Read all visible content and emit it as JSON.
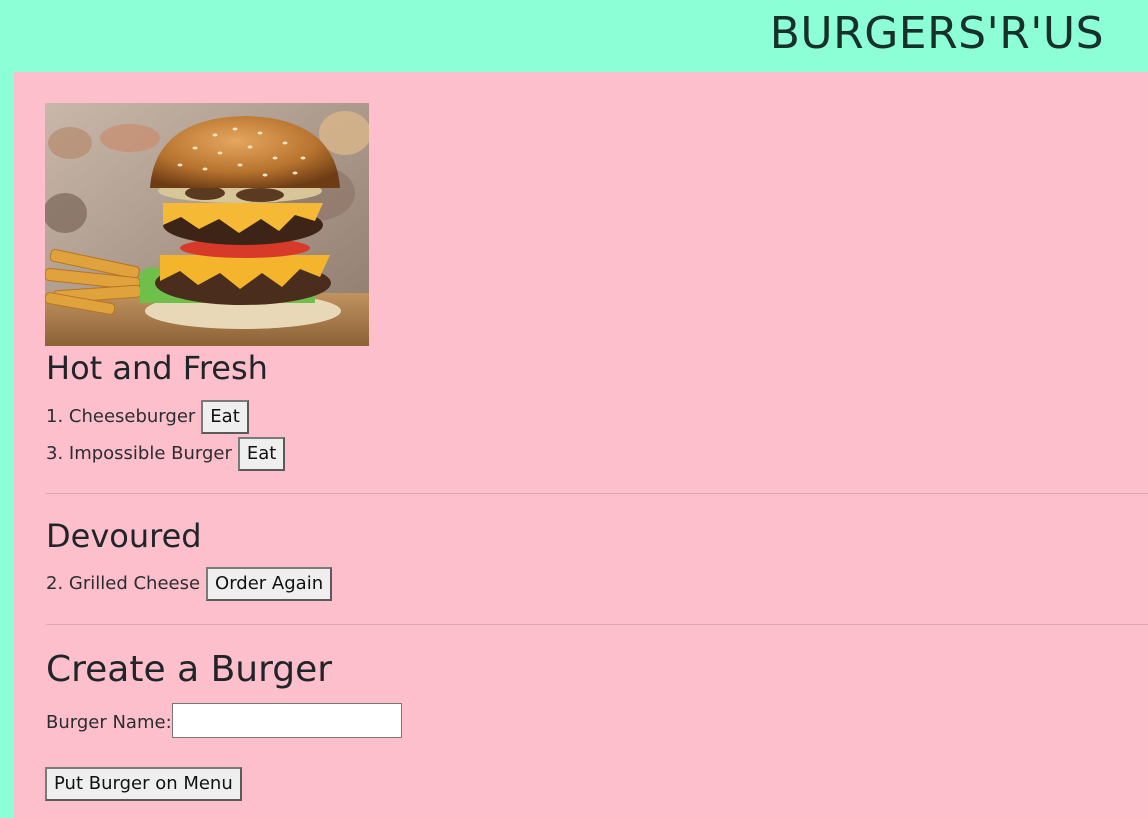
{
  "header": {
    "brand": "BURGERS'R'US"
  },
  "sections": {
    "hot": {
      "title": "Hot and Fresh",
      "items": [
        {
          "label": "1. Cheeseburger",
          "button": "Eat"
        },
        {
          "label": "3. Impossible Burger",
          "button": "Eat"
        }
      ]
    },
    "devoured": {
      "title": "Devoured",
      "items": [
        {
          "label": "2. Grilled Cheese",
          "button": "Order Again"
        }
      ]
    },
    "create": {
      "title": "Create a Burger",
      "field_label": "Burger Name:",
      "field_value": "",
      "submit_label": "Put Burger on Menu"
    }
  },
  "colors": {
    "header_bg": "#8cffd6",
    "main_bg": "#fcbfcb"
  },
  "hero_image": "burger-photo"
}
